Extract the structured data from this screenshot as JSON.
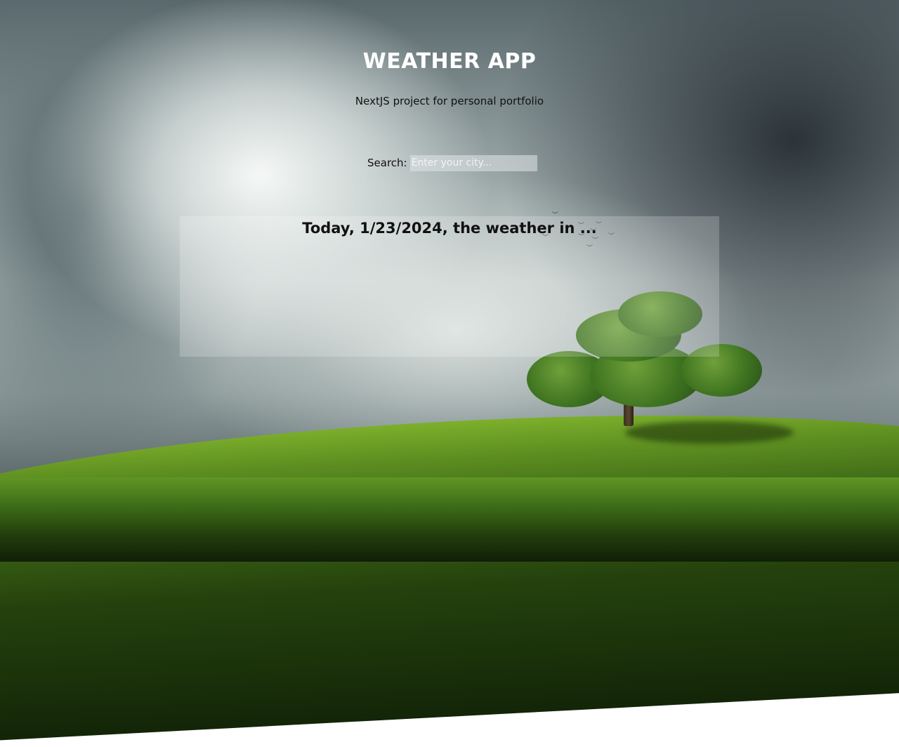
{
  "app": {
    "title": "WEATHER APP",
    "subtitle": "NextJS project for personal portfolio"
  },
  "search": {
    "label": "Search:",
    "placeholder": "Enter your city...",
    "value": ""
  },
  "weather": {
    "heading": "Today, 1/23/2024, the weather in ..."
  },
  "colors": {
    "title_text": "#ffffff",
    "body_text": "#111111",
    "panel_background": "rgba(255,255,255,0.2)"
  },
  "background": {
    "scene": "stormy-sky-green-hill-tree"
  }
}
